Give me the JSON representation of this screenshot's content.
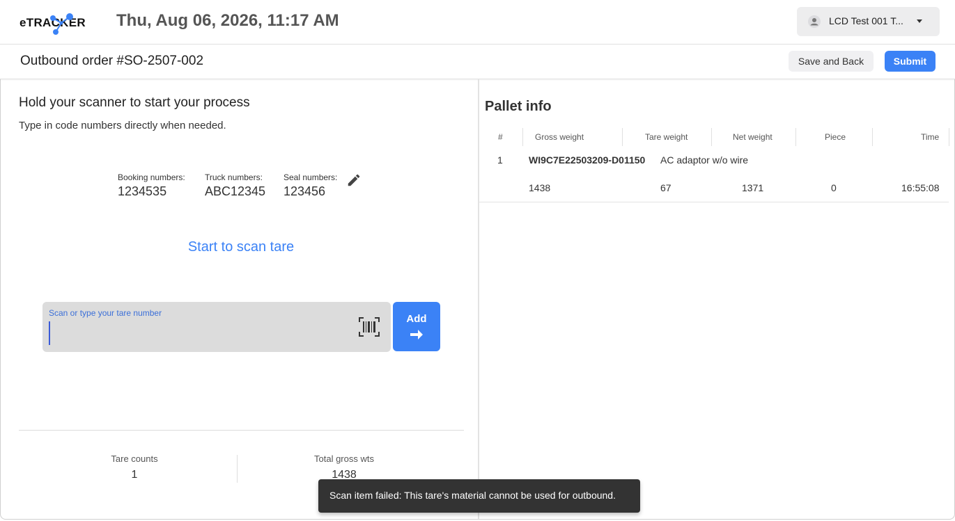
{
  "header": {
    "logo_text": "eTRACKER",
    "datetime": "Thu, Aug 06, 2026, 11:17 AM",
    "user_name": "LCD Test 001 T..."
  },
  "order": {
    "title": "Outbound order #SO-2507-002",
    "save_back_label": "Save and Back",
    "submit_label": "Submit"
  },
  "scanner": {
    "title": "Hold your scanner to start your process",
    "subtitle": "Type in code numbers directly when needed.",
    "booking_label": "Booking numbers:",
    "booking_value": "1234535",
    "truck_label": "Truck numbers:",
    "truck_value": "ABC12345",
    "seal_label": "Seal numbers:",
    "seal_value": "123456",
    "scan_prompt": "Start to scan tare",
    "input_label": "Scan or type your tare number",
    "input_value": "",
    "add_label": "Add"
  },
  "stats": {
    "tare_counts_label": "Tare counts",
    "tare_counts_value": "1",
    "total_gross_label": "Total gross wts",
    "total_gross_value": "1438"
  },
  "pallet": {
    "title": "Pallet info",
    "columns": [
      "#",
      "Gross weight",
      "Tare weight",
      "Net weight",
      "Piece",
      "Time"
    ],
    "rows": [
      {
        "index": "1",
        "code": "WI9C7E22503209-D01150",
        "description": "AC adaptor w/o wire",
        "gross_weight": "1438",
        "tare_weight": "67",
        "net_weight": "1371",
        "piece": "0",
        "time": "16:55:08"
      }
    ]
  },
  "toast": {
    "message": "Scan item failed: This tare's material cannot be used for outbound."
  },
  "colors": {
    "accent": "#3b82f6",
    "toast_bg": "#333333",
    "logo_node": "#3b82f6"
  }
}
